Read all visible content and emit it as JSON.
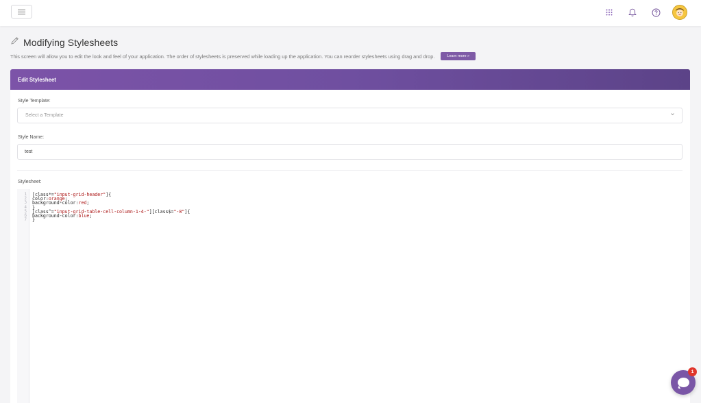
{
  "header": {
    "icons": [
      "menu-icon",
      "apps-grid-icon",
      "bell-icon",
      "help-icon",
      "user-avatar"
    ]
  },
  "page": {
    "title": "Modifying Stylesheets",
    "title_icon": "pencil-icon",
    "description": "This screen will allow you to edit the look and feel of your application. The order of stylesheets is preserved while loading up the application. You can reorder stylesheets using drag and drop.",
    "learn_more_label": "Learn more »"
  },
  "card": {
    "title": "Edit Stylesheet",
    "style_template": {
      "label": "Style Template:",
      "placeholder": "Select a Template"
    },
    "style_name": {
      "label": "Style Name:",
      "value": "test"
    },
    "stylesheet": {
      "label": "Stylesheet:",
      "line_numbers": [
        "1",
        "2",
        "3",
        "4",
        "5",
        "6",
        "7"
      ],
      "lines": [
        {
          "a": "[class*=",
          "s": "\"input-grid-header\"",
          "b": "]{",
          "v": "",
          "c": ""
        },
        {
          "a": "color:",
          "s": "",
          "b": "",
          "v": "orange",
          "c": ";"
        },
        {
          "a": "background-color:",
          "s": "",
          "b": "",
          "v": "red",
          "c": ";"
        },
        {
          "a": "}",
          "s": "",
          "b": "",
          "v": "",
          "c": ""
        },
        {
          "a": "[class^=",
          "s": "\"input-grid-table-cell-column-1-4-\"",
          "b": "][class$=",
          "v": "\"-8\"",
          "c": "]{"
        },
        {
          "a": "background-color:",
          "s": "",
          "b": "",
          "v": "blue",
          "c": ";"
        },
        {
          "a": "}",
          "s": "",
          "b": "",
          "v": "",
          "c": ""
        }
      ]
    }
  },
  "chat": {
    "badge_count": "1"
  },
  "colors": {
    "accent": "#7e5aa6",
    "badge": "#e0352b"
  }
}
